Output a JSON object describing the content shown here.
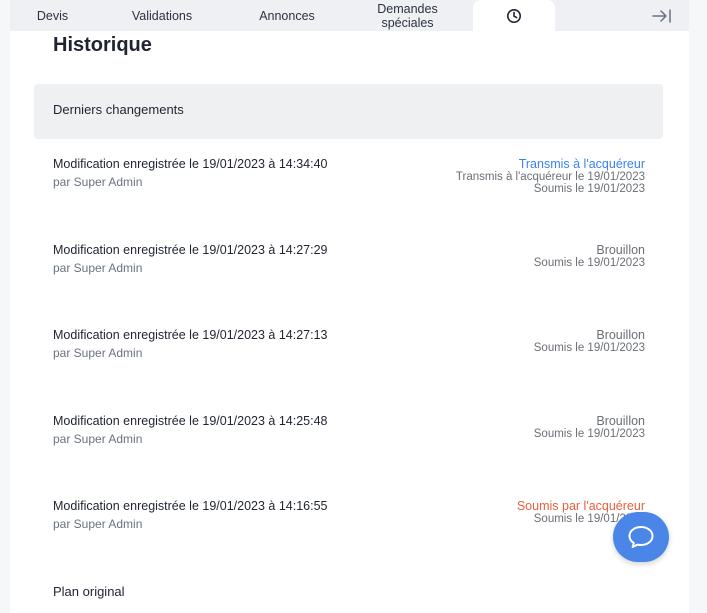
{
  "tabs": {
    "devis": "Devis",
    "validations": "Validations",
    "annonces": "Annonces",
    "demandes": "Demandes spéciales",
    "history_icon": "clock-icon",
    "collapse_icon": "collapse-right-icon"
  },
  "page": {
    "title": "Historique",
    "section_title": "Derniers changements",
    "plan_label": "Plan original"
  },
  "entries": [
    {
      "title": "Modification enregistrée le 19/01/2023 à 14:34:40",
      "by": "par Super Admin",
      "status": "Transmis à l'acquéreur",
      "lines": [
        "Transmis à l'acquéreur le 19/01/2023",
        "Soumis le 19/01/2023"
      ]
    },
    {
      "title": "Modification enregistrée le 19/01/2023 à 14:27:29",
      "by": "par Super Admin",
      "status": "Brouillon",
      "lines": [
        "Soumis le 19/01/2023"
      ]
    },
    {
      "title": "Modification enregistrée le 19/01/2023 à 14:27:13",
      "by": "par Super Admin",
      "status": "Brouillon",
      "lines": [
        "Soumis le 19/01/2023"
      ]
    },
    {
      "title": "Modification enregistrée le 19/01/2023 à 14:25:48",
      "by": "par Super Admin",
      "status": "Brouillon",
      "lines": [
        "Soumis le 19/01/2023"
      ]
    },
    {
      "title": "Modification enregistrée le 19/01/2023 à 14:16:55",
      "by": "par Super Admin",
      "status": "Soumis par l'acquéreur",
      "lines": [
        "Soumis le 19/01/2023"
      ]
    }
  ],
  "colors": {
    "accent_blue": "#3b82f6",
    "accent_orange": "#e8603c",
    "chat_bubble": "#4a86e8"
  },
  "chat": {
    "icon": "chat-bubble-icon"
  }
}
